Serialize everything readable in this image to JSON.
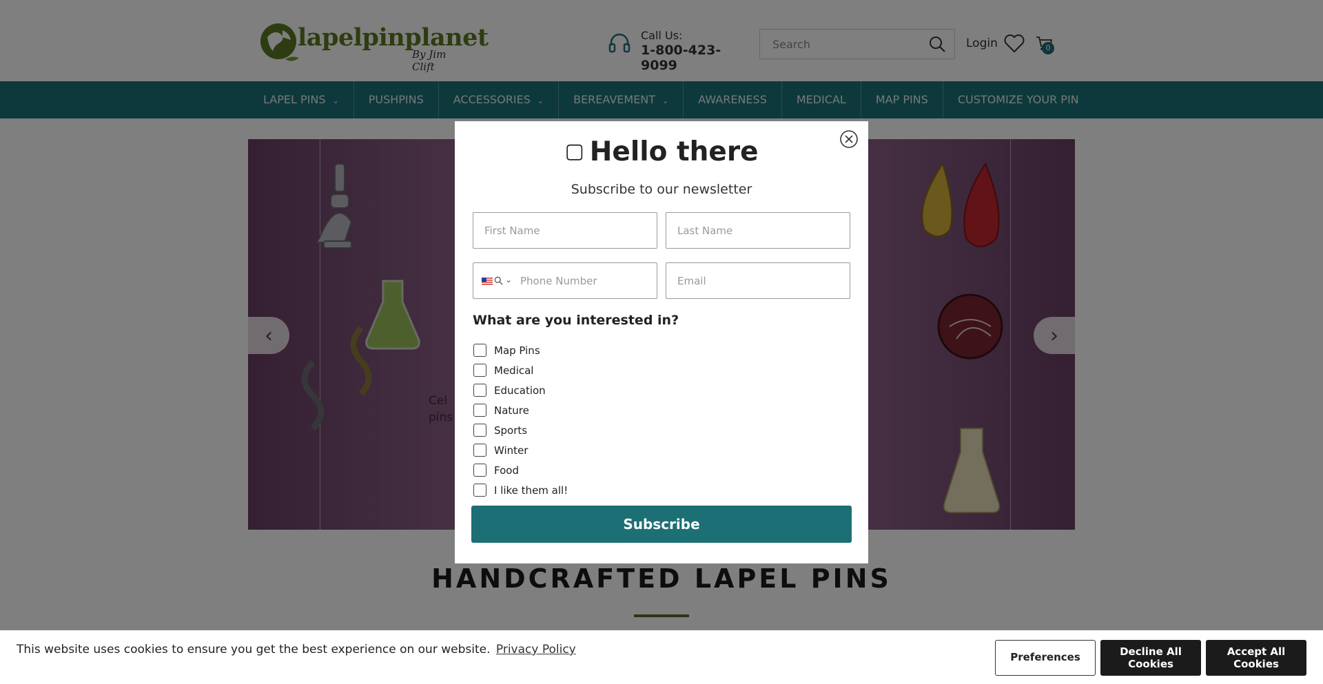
{
  "header": {
    "logo_text": "lapelpinplanet",
    "logo_sub": "By Jim Clift",
    "call_label": "Call Us:",
    "call_number": "1-800-423-9099",
    "search_placeholder": "Search",
    "login_label": "Login",
    "cart_count": "0"
  },
  "nav": {
    "items": [
      {
        "label": "LAPEL PINS",
        "dropdown": true
      },
      {
        "label": "PUSHPINS",
        "dropdown": false
      },
      {
        "label": "ACCESSORIES",
        "dropdown": true
      },
      {
        "label": "BEREAVEMENT",
        "dropdown": true
      },
      {
        "label": "AWARENESS",
        "dropdown": false
      },
      {
        "label": "MEDICAL",
        "dropdown": false
      },
      {
        "label": "MAP PINS",
        "dropdown": false
      },
      {
        "label": "CUSTOMIZE YOUR PIN",
        "dropdown": false
      }
    ]
  },
  "hero": {
    "text_line1": "Cel",
    "text_line2": "pins"
  },
  "section": {
    "title": "HANDCRAFTED LAPEL PINS"
  },
  "modal": {
    "title": "Hello there",
    "subtitle": "Subscribe to our newsletter",
    "first_name_placeholder": "First Name",
    "last_name_placeholder": "Last Name",
    "phone_placeholder": "Phone Number",
    "email_placeholder": "Email",
    "interest_question": "What are you interested in?",
    "options": [
      "Map Pins",
      "Medical",
      "Education",
      "Nature",
      "Sports",
      "Winter",
      "Food",
      "I like them all!"
    ],
    "subscribe_label": "Subscribe"
  },
  "cookie": {
    "text": "This website uses cookies to ensure you get the best experience on our website.",
    "link": "Privacy Policy",
    "preferences": "Preferences",
    "decline": "Decline All Cookies",
    "accept": "Accept All Cookies"
  },
  "colors": {
    "brand_teal": "#1c7278",
    "logo_green": "#5b7a23",
    "button_dark": "#1b1b1b"
  }
}
